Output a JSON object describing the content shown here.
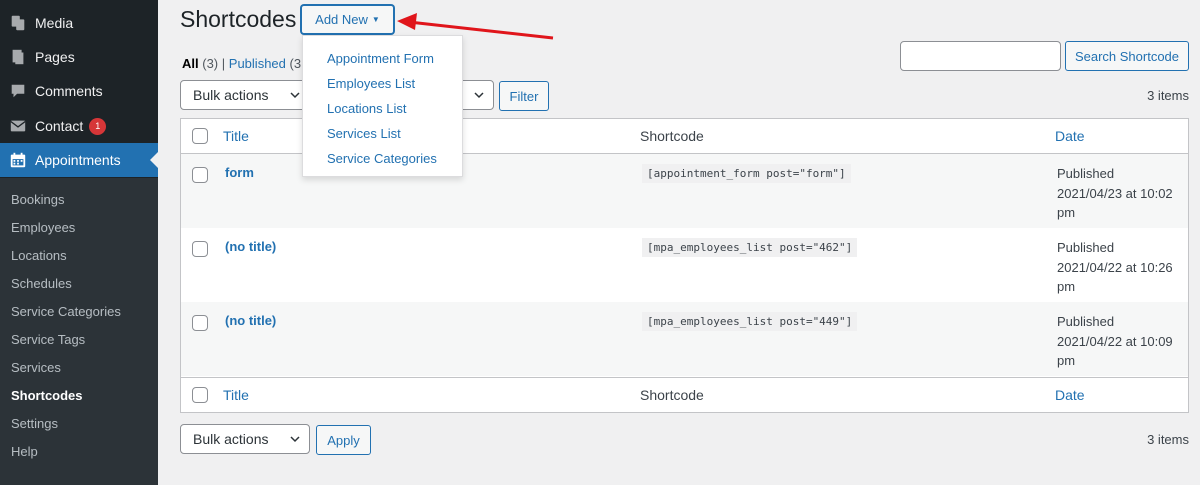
{
  "sidebar": {
    "menu": [
      {
        "label": "Media",
        "icon": "media-icon"
      },
      {
        "label": "Pages",
        "icon": "pages-icon"
      },
      {
        "label": "Comments",
        "icon": "comments-icon"
      },
      {
        "label": "Contact",
        "icon": "mail-icon",
        "badge": "1"
      },
      {
        "label": "Appointments",
        "icon": "calendar-icon",
        "active": true
      }
    ],
    "submenu": [
      {
        "label": "Bookings"
      },
      {
        "label": "Employees"
      },
      {
        "label": "Locations"
      },
      {
        "label": "Schedules"
      },
      {
        "label": "Service Categories"
      },
      {
        "label": "Service Tags"
      },
      {
        "label": "Services"
      },
      {
        "label": "Shortcodes",
        "current": true
      },
      {
        "label": "Settings"
      },
      {
        "label": "Help"
      }
    ]
  },
  "header": {
    "title": "Shortcodes",
    "add_new_label": "Add New",
    "add_new_caret": "▼"
  },
  "dropdown": {
    "items": [
      "Appointment Form",
      "Employees List",
      "Locations List",
      "Services List",
      "Service Categories"
    ]
  },
  "filters": {
    "all_label": "All",
    "all_count": "(3)",
    "separator": "|",
    "published_label": "Published",
    "published_count": "(3"
  },
  "search": {
    "value": "",
    "button_label": "Search Shortcode"
  },
  "top_nav": {
    "bulk_actions": "Bulk actions",
    "filter_label": "Filter",
    "items_count": "3 items"
  },
  "bottom_nav": {
    "bulk_actions": "Bulk actions",
    "apply_label": "Apply",
    "items_count": "3 items"
  },
  "table": {
    "columns": {
      "title": "Title",
      "shortcode": "Shortcode",
      "date": "Date"
    },
    "rows": [
      {
        "title": "form",
        "shortcode": "[appointment_form post=\"form\"]",
        "status": "Published",
        "date_line": "2021/04/23 at 10:02",
        "date_tail": "pm"
      },
      {
        "title": "(no title)",
        "shortcode": "[mpa_employees_list post=\"462\"]",
        "status": "Published",
        "date_line": "2021/04/22 at 10:26",
        "date_tail": "pm"
      },
      {
        "title": "(no title)",
        "shortcode": "[mpa_employees_list post=\"449\"]",
        "status": "Published",
        "date_line": "2021/04/22 at 10:09",
        "date_tail": "pm"
      }
    ]
  },
  "colors": {
    "sidebar_bg": "#1d2327",
    "accent": "#2271b1",
    "active_menu": "#2271b1",
    "badge": "#d63638",
    "arrow": "#e0151b"
  }
}
